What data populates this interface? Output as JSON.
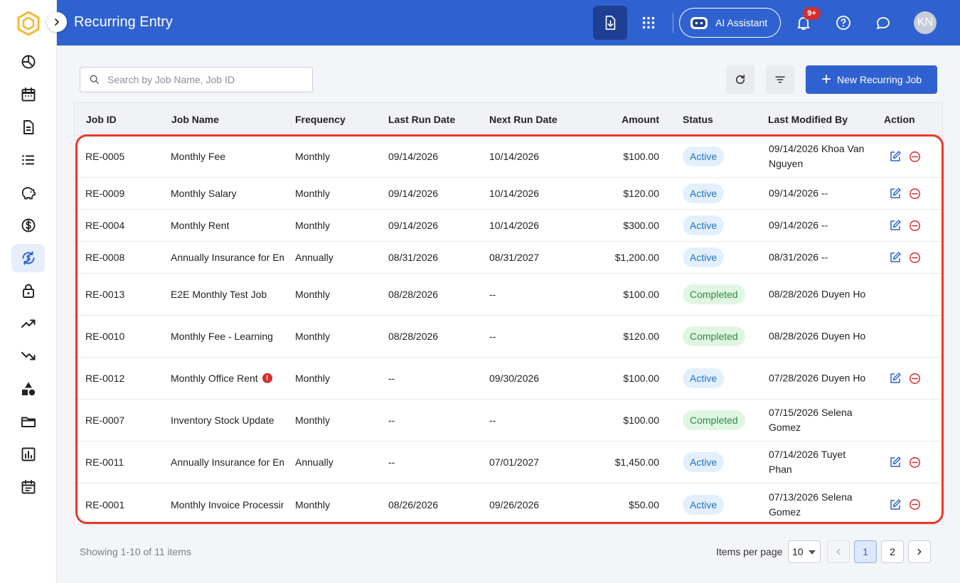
{
  "header": {
    "title": "Recurring Entry",
    "ai_label": "AI Assistant",
    "notification_badge": "9+",
    "avatar_initials": "KN"
  },
  "sidebar": {
    "items": [
      {
        "icon": "dashboard-pie-icon"
      },
      {
        "icon": "calendar-icon"
      },
      {
        "icon": "document-icon"
      },
      {
        "icon": "list-icon"
      },
      {
        "icon": "piggy-bank-icon"
      },
      {
        "icon": "dollar-icon"
      },
      {
        "icon": "recurring-dollar-icon",
        "active": true
      },
      {
        "icon": "lock-icon"
      },
      {
        "icon": "trending-up-icon"
      },
      {
        "icon": "trending-down-icon"
      },
      {
        "icon": "shapes-icon"
      },
      {
        "icon": "folder-icon"
      },
      {
        "icon": "bar-chart-icon"
      },
      {
        "icon": "schedule-icon"
      }
    ]
  },
  "toolbar": {
    "search_placeholder": "Search by Job Name, Job ID",
    "new_label": "New Recurring Job"
  },
  "table": {
    "columns": [
      "Job ID",
      "Job Name",
      "Frequency",
      "Last Run Date",
      "Next Run Date",
      "Amount",
      "Status",
      "Last Modified By",
      "Action"
    ],
    "rows": [
      {
        "id": "RE-0005",
        "name": "Monthly Fee",
        "freq": "Monthly",
        "last": "09/14/2026",
        "next": "10/14/2026",
        "amount": "$100.00",
        "status": "Active",
        "modified": "09/14/2026 Khoa Van Nguyen"
      },
      {
        "id": "RE-0009",
        "name": "Monthly Salary",
        "freq": "Monthly",
        "last": "09/14/2026",
        "next": "10/14/2026",
        "amount": "$120.00",
        "status": "Active",
        "modified": "09/14/2026 --"
      },
      {
        "id": "RE-0004",
        "name": "Monthly Rent",
        "freq": "Monthly",
        "last": "09/14/2026",
        "next": "10/14/2026",
        "amount": "$300.00",
        "status": "Active",
        "modified": "09/14/2026 --"
      },
      {
        "id": "RE-0008",
        "name": "Annually Insurance for Employees",
        "freq": "Annually",
        "last": "08/31/2026",
        "next": "08/31/2027",
        "amount": "$1,200.00",
        "status": "Active",
        "modified": "08/31/2026 --"
      },
      {
        "id": "RE-0013",
        "name": "E2E Monthly Test Job",
        "freq": "Monthly",
        "last": "08/28/2026",
        "next": "--",
        "amount": "$100.00",
        "status": "Completed",
        "modified": "08/28/2026 Duyen Ho"
      },
      {
        "id": "RE-0010",
        "name": "Monthly Fee - Learning",
        "freq": "Monthly",
        "last": "08/28/2026",
        "next": "--",
        "amount": "$120.00",
        "status": "Completed",
        "modified": "08/28/2026 Duyen Ho"
      },
      {
        "id": "RE-0012",
        "name": "Monthly Office Rent",
        "freq": "Monthly",
        "last": "--",
        "next": "09/30/2026",
        "amount": "$100.00",
        "status": "Active",
        "modified": "07/28/2026 Duyen Ho",
        "warning": true
      },
      {
        "id": "RE-0007",
        "name": "Inventory Stock Update",
        "freq": "Monthly",
        "last": "--",
        "next": "--",
        "amount": "$100.00",
        "status": "Completed",
        "modified": "07/15/2026 Selena Gomez"
      },
      {
        "id": "RE-0011",
        "name": "Annually Insurance for Employees",
        "freq": "Annually",
        "last": "--",
        "next": "07/01/2027",
        "amount": "$1,450.00",
        "status": "Active",
        "modified": "07/14/2026 Tuyet Phan"
      },
      {
        "id": "RE-0001",
        "name": "Monthly Invoice Processing",
        "freq": "Monthly",
        "last": "08/26/2026",
        "next": "09/26/2026",
        "amount": "$50.00",
        "status": "Active",
        "modified": "07/13/2026 Selena Gomez"
      }
    ]
  },
  "footer": {
    "showing": "Showing 1-10 of 11 items",
    "ipp_label": "Items per page",
    "ipp_value": "10",
    "pages": [
      "1",
      "2"
    ],
    "current_page": "1"
  },
  "colors": {
    "primary": "#2f62d0",
    "highlight": "#e53a2a",
    "active_bg": "#e3f0fc",
    "completed_bg": "#e0f6e3"
  }
}
